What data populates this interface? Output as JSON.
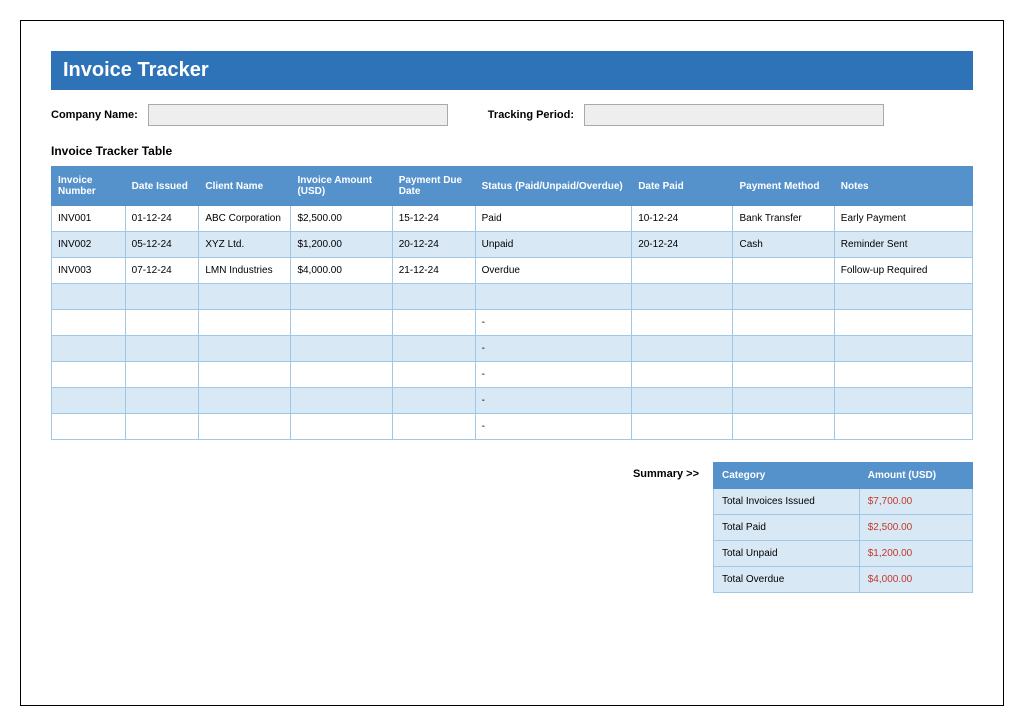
{
  "title": "Invoice Tracker",
  "meta": {
    "company_label": "Company Name:",
    "company_value": "",
    "period_label": "Tracking Period:",
    "period_value": ""
  },
  "subheading": "Invoice Tracker Table",
  "columns": {
    "invoice_number": "Invoice Number",
    "date_issued": "Date Issued",
    "client_name": "Client Name",
    "invoice_amount": "Invoice Amount (USD)",
    "payment_due": "Payment Due Date",
    "status": "Status (Paid/Unpaid/Overdue)",
    "date_paid": "Date Paid",
    "payment_method": "Payment Method",
    "notes": "Notes"
  },
  "rows": [
    {
      "invoice_number": "INV001",
      "date_issued": "01-12-24",
      "client_name": "ABC Corporation",
      "invoice_amount": "$2,500.00",
      "payment_due": "15-12-24",
      "status": "Paid",
      "status_overdue": false,
      "date_paid": "10-12-24",
      "payment_method": "Bank Transfer",
      "notes": "Early Payment"
    },
    {
      "invoice_number": "INV002",
      "date_issued": "05-12-24",
      "client_name": "XYZ Ltd.",
      "invoice_amount": "$1,200.00",
      "payment_due": "20-12-24",
      "status": "Unpaid",
      "status_overdue": false,
      "date_paid": "20-12-24",
      "payment_method": "Cash",
      "notes": "Reminder Sent"
    },
    {
      "invoice_number": "INV003",
      "date_issued": "07-12-24",
      "client_name": "LMN Industries",
      "invoice_amount": "$4,000.00",
      "payment_due": "21-12-24",
      "status": "Overdue",
      "status_overdue": true,
      "date_paid": "",
      "payment_method": "",
      "notes": "Follow-up Required"
    },
    {
      "invoice_number": "",
      "date_issued": "",
      "client_name": "",
      "invoice_amount": "",
      "payment_due": "",
      "status": "",
      "status_overdue": false,
      "date_paid": "",
      "payment_method": "",
      "notes": ""
    },
    {
      "invoice_number": "",
      "date_issued": "",
      "client_name": "",
      "invoice_amount": "",
      "payment_due": "",
      "status": "-",
      "status_overdue": false,
      "date_paid": "",
      "payment_method": "",
      "notes": ""
    },
    {
      "invoice_number": "",
      "date_issued": "",
      "client_name": "",
      "invoice_amount": "",
      "payment_due": "",
      "status": "-",
      "status_overdue": false,
      "date_paid": "",
      "payment_method": "",
      "notes": ""
    },
    {
      "invoice_number": "",
      "date_issued": "",
      "client_name": "",
      "invoice_amount": "",
      "payment_due": "",
      "status": "-",
      "status_overdue": false,
      "date_paid": "",
      "payment_method": "",
      "notes": ""
    },
    {
      "invoice_number": "",
      "date_issued": "",
      "client_name": "",
      "invoice_amount": "",
      "payment_due": "",
      "status": "-",
      "status_overdue": false,
      "date_paid": "",
      "payment_method": "",
      "notes": ""
    },
    {
      "invoice_number": "",
      "date_issued": "",
      "client_name": "",
      "invoice_amount": "",
      "payment_due": "",
      "status": "-",
      "status_overdue": false,
      "date_paid": "",
      "payment_method": "",
      "notes": ""
    }
  ],
  "summary_label": "Summary >>",
  "summary_columns": {
    "category": "Category",
    "amount": "Amount (USD)"
  },
  "summary_rows": [
    {
      "category": "Total Invoices Issued",
      "amount": "$7,700.00"
    },
    {
      "category": "Total Paid",
      "amount": "$2,500.00"
    },
    {
      "category": "Total Unpaid",
      "amount": "$1,200.00"
    },
    {
      "category": "Total Overdue",
      "amount": "$4,000.00"
    }
  ]
}
